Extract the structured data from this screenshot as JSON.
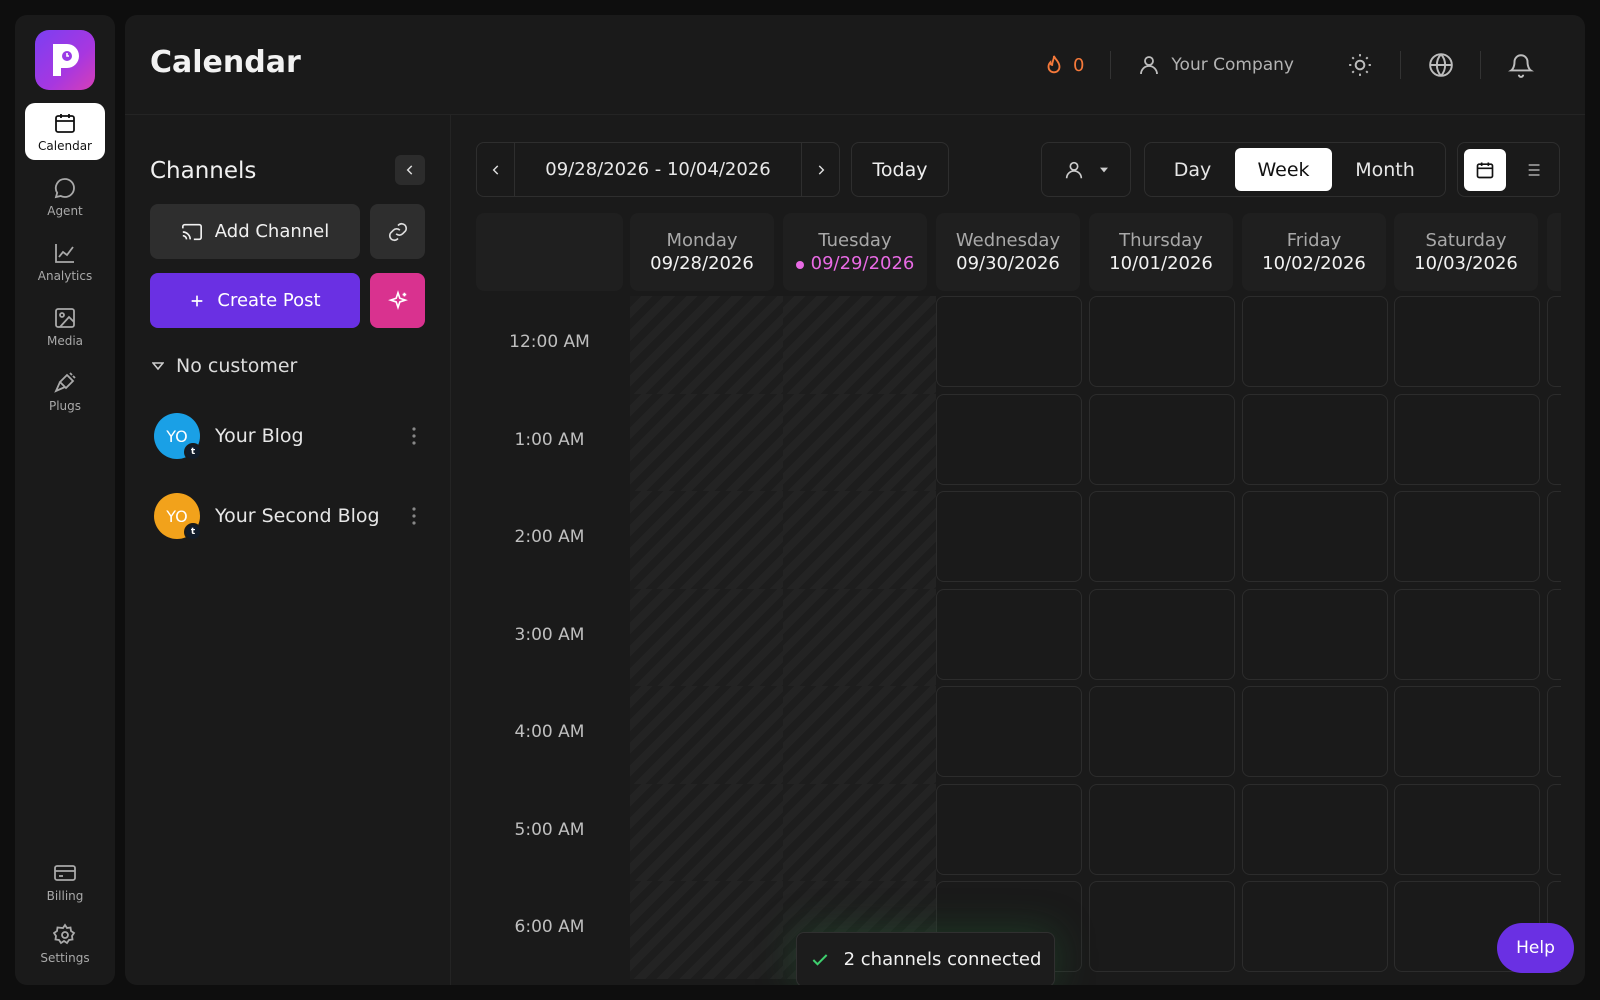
{
  "nav": {
    "items": [
      {
        "id": "calendar",
        "label": "Calendar",
        "icon": "calendar-icon",
        "active": true
      },
      {
        "id": "agent",
        "label": "Agent",
        "icon": "chat-bubble-icon"
      },
      {
        "id": "analytics",
        "label": "Analytics",
        "icon": "line-chart-icon"
      },
      {
        "id": "media",
        "label": "Media",
        "icon": "image-icon"
      },
      {
        "id": "plugs",
        "label": "Plugs",
        "icon": "plug-icon"
      }
    ],
    "bottom": [
      {
        "id": "billing",
        "label": "Billing",
        "icon": "credit-card-icon"
      },
      {
        "id": "settings",
        "label": "Settings",
        "icon": "gear-icon"
      }
    ]
  },
  "header": {
    "title": "Calendar",
    "streak_count": "0",
    "company": "Your Company"
  },
  "channels": {
    "title": "Channels",
    "add_channel": "Add Channel",
    "create_post": "Create Post",
    "customer": "No customer",
    "list": [
      {
        "initials": "YO",
        "name": "Your Blog",
        "color": "#1aa0e6",
        "badge": "t"
      },
      {
        "initials": "YO",
        "name": "Your Second Blog",
        "color": "#f2a21b",
        "badge": "t"
      }
    ]
  },
  "calendar": {
    "range": "09/28/2026 - 10/04/2026",
    "today_label": "Today",
    "views": [
      "Day",
      "Week",
      "Month"
    ],
    "active_view": "Week",
    "days": [
      {
        "name": "Monday",
        "date": "09/28/2026",
        "past": true
      },
      {
        "name": "Tuesday",
        "date": "09/29/2026",
        "today": true,
        "past": true
      },
      {
        "name": "Wednesday",
        "date": "09/30/2026"
      },
      {
        "name": "Thursday",
        "date": "10/01/2026"
      },
      {
        "name": "Friday",
        "date": "10/02/2026"
      },
      {
        "name": "Saturday",
        "date": "10/03/2026"
      },
      {
        "name": "",
        "date": ""
      }
    ],
    "hours": [
      "12:00 AM",
      "1:00 AM",
      "2:00 AM",
      "3:00 AM",
      "4:00 AM",
      "5:00 AM",
      "6:00 AM"
    ]
  },
  "toast": {
    "message": "2 channels connected"
  },
  "help": {
    "label": "Help"
  },
  "colors": {
    "accent": "#6a30e3",
    "pink": "#d9328f",
    "today": "#e86ae4",
    "streak": "#f5793a"
  }
}
